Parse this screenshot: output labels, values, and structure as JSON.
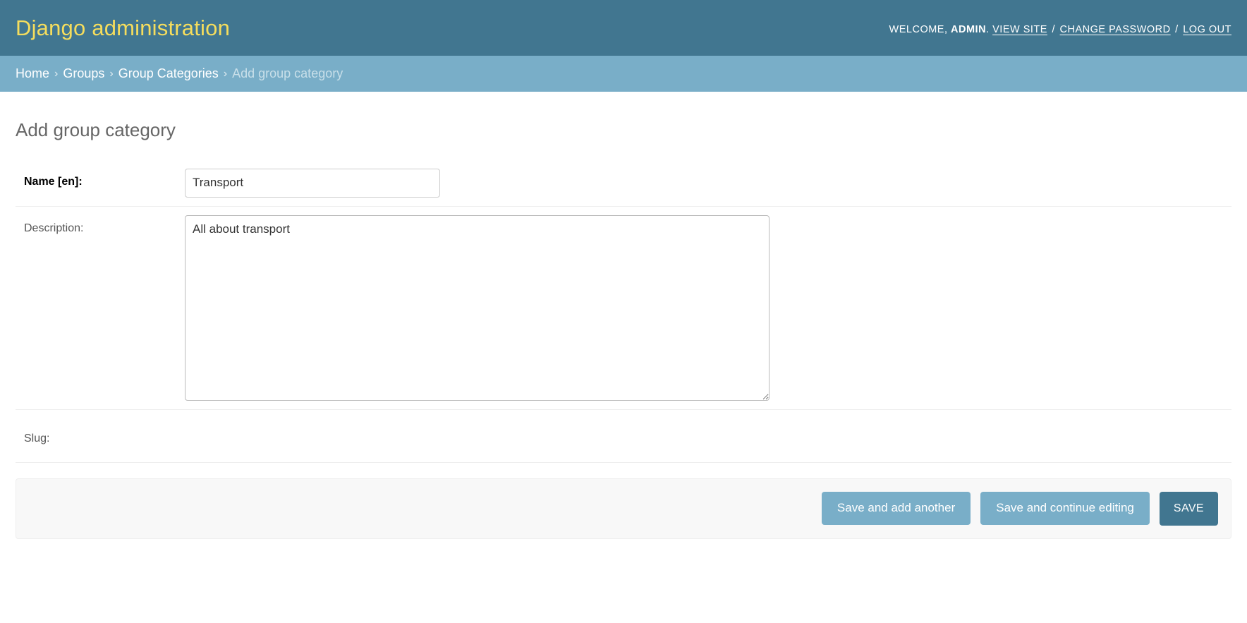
{
  "header": {
    "site_title": "Django administration",
    "user_tools": {
      "welcome_prefix": "WELCOME,",
      "username": "ADMIN",
      "period": ".",
      "view_site": "VIEW SITE",
      "separator": "/",
      "change_password": "CHANGE PASSWORD",
      "log_out": "LOG OUT"
    }
  },
  "breadcrumbs": {
    "separator": "›",
    "items": [
      {
        "label": "Home",
        "current": false
      },
      {
        "label": "Groups",
        "current": false
      },
      {
        "label": "Group Categories",
        "current": false
      },
      {
        "label": "Add group category",
        "current": true
      }
    ]
  },
  "content": {
    "title": "Add group category",
    "fields": {
      "name": {
        "label": "Name [en]:",
        "value": "Transport",
        "placeholder": "",
        "required": true
      },
      "description": {
        "label": "Description:",
        "value": "All about transport",
        "placeholder": "",
        "required": false
      },
      "slug": {
        "label": "Slug:",
        "value": "",
        "placeholder": "",
        "required": false
      }
    }
  },
  "submit_row": {
    "save_and_add_another": "Save and add another",
    "save_and_continue": "Save and continue editing",
    "save": "SAVE"
  },
  "colors": {
    "header_bg": "#417690",
    "header_title": "#f5dd5d",
    "breadcrumb_bg": "#79aec8",
    "button_bg": "#79aec8",
    "button_default_bg": "#417690",
    "page_bg": "#ffffff",
    "submit_row_bg": "#f8f8f8",
    "title_text": "#666666"
  }
}
